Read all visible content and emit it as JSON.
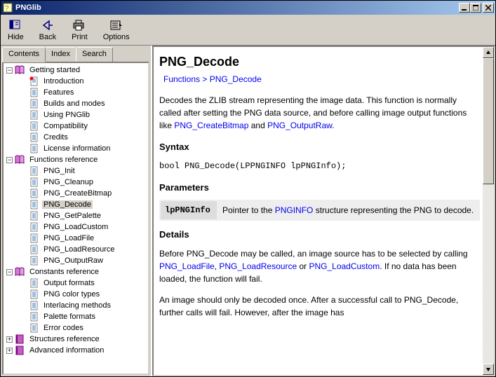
{
  "window": {
    "title": "PNGlib"
  },
  "toolbar": {
    "hide": "Hide",
    "back": "Back",
    "print": "Print",
    "options": "Options"
  },
  "tabs": {
    "contents": "Contents",
    "index": "Index",
    "search": "Search"
  },
  "tree": {
    "sections": [
      {
        "label": "Getting started",
        "expanded": true,
        "items": [
          "Introduction",
          "Features",
          "Builds and modes",
          "Using PNGlib",
          "Compatibility",
          "Credits",
          "License information"
        ]
      },
      {
        "label": "Functions reference",
        "expanded": true,
        "items": [
          "PNG_Init",
          "PNG_Cleanup",
          "PNG_CreateBitmap",
          "PNG_Decode",
          "PNG_GetPalette",
          "PNG_LoadCustom",
          "PNG_LoadFile",
          "PNG_LoadResource",
          "PNG_OutputRaw"
        ],
        "selected": "PNG_Decode"
      },
      {
        "label": "Constants reference",
        "expanded": true,
        "items": [
          "Output formats",
          "PNG color types",
          "Interlacing methods",
          "Palette formats",
          "Error codes"
        ]
      },
      {
        "label": "Structures reference",
        "expanded": false
      },
      {
        "label": "Advanced information",
        "expanded": false
      }
    ]
  },
  "doc": {
    "title": "PNG_Decode",
    "crumb_functions": "Functions",
    "crumb_sep": " > ",
    "crumb_current": "PNG_Decode",
    "intro_a": "Decodes the ZLIB stream representing the image data. This function is normally called after setting the PNG data source, and before calling image output functions like ",
    "intro_link1": "PNG_CreateBitmap",
    "intro_b": " and ",
    "intro_link2": "PNG_OutputRaw",
    "intro_c": ".",
    "h_syntax": "Syntax",
    "syntax_code": "bool PNG_Decode(LPPNGINFO lpPNGInfo);",
    "h_params": "Parameters",
    "param_name": "lpPNGInfo",
    "param_desc_a": "Pointer to the ",
    "param_link": "PNGINFO",
    "param_desc_b": " structure representing the PNG to decode.",
    "h_details": "Details",
    "details1_a": "Before PNG_Decode may be called, an image source has to be selected by calling ",
    "details1_l1": "PNG_LoadFile",
    "details1_b": ", ",
    "details1_l2": "PNG_LoadResource",
    "details1_c": " or ",
    "details1_l3": "PNG_LoadCustom",
    "details1_d": ". If no data has been loaded, the function will fail.",
    "details2": "An image should only be decoded once. After a successful call to PNG_Decode, further calls will fail. However, after the image has"
  }
}
